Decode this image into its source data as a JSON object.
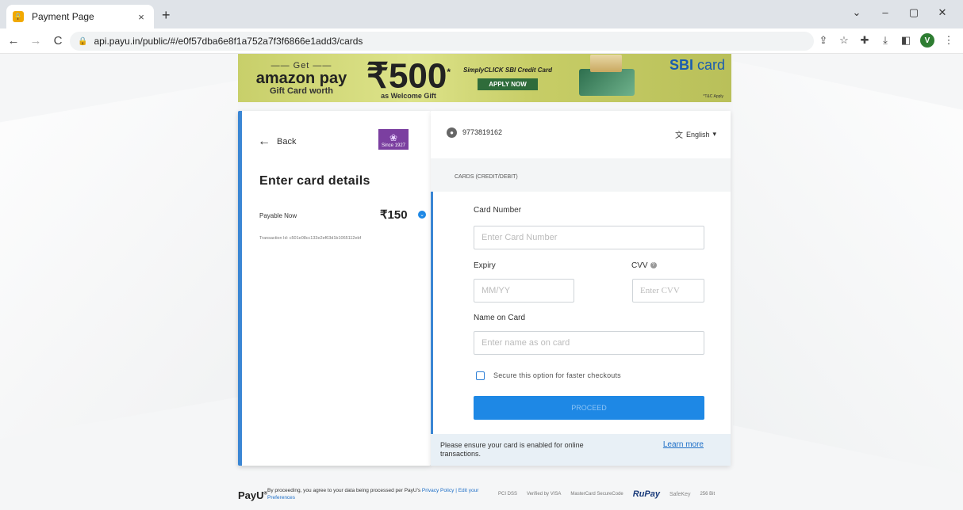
{
  "browser": {
    "tab_title": "Payment Page",
    "tab_close": "×",
    "new_tab": "+",
    "url": "api.payu.in/public/#/e0f57dba6e8f1a752a7f3f6866e1add3/cards",
    "profile_initial": "V",
    "window_controls": [
      "⌄",
      "–",
      "▢",
      "✕"
    ]
  },
  "banner": {
    "get": "—— Get ——",
    "amazon_pay": "amazon pay",
    "gift_card_worth": "Gift Card worth",
    "amount": "₹500",
    "amount_star": "*",
    "welcome_gift": "as Welcome Gift",
    "product": "SimplyCLICK SBI Credit Card",
    "apply_now": "APPLY NOW",
    "brand_sbi": "SBI",
    "brand_card": "card",
    "tnc": "*T&C Apply"
  },
  "left_panel": {
    "back_label": "Back",
    "merchant_tag": "Since 1927",
    "title": "Enter card details",
    "payable_label": "Payable Now",
    "payable_amount": "₹150",
    "transaction_id": "Transaction Id: c501e08cc133e2ef63d1b1065112ebf"
  },
  "right_panel": {
    "phone": "9773819162",
    "language": "English",
    "section_label": "CARDS (CREDIT/DEBIT)",
    "card_number_label": "Card Number",
    "card_number_placeholder": "Enter Card Number",
    "expiry_label": "Expiry",
    "expiry_placeholder": "MM/YY",
    "cvv_label": "CVV",
    "cvv_placeholder": "Enter CVV",
    "name_label": "Name on Card",
    "name_placeholder": "Enter name as on card",
    "secure_label": "Secure this option for faster checkouts",
    "proceed_label": "PROCEED",
    "notice": "Please ensure your card is enabled for online transactions.",
    "learn_more": "Learn more"
  },
  "footer": {
    "logo": "PayU",
    "text_prefix": "By proceeding, you agree to your data being processed per PayU's ",
    "privacy": "Privacy Policy",
    "separator": " | ",
    "prefs": "Edit your Preferences",
    "badges": [
      "PCI DSS",
      "Verified by VISA",
      "MasterCard SecureCode",
      "RuPay",
      "SafeKey",
      "256 Bit"
    ]
  },
  "colors": {
    "accent": "#3a86d4",
    "proceed_bg": "#1e88e5",
    "link": "#1e6fc7"
  }
}
